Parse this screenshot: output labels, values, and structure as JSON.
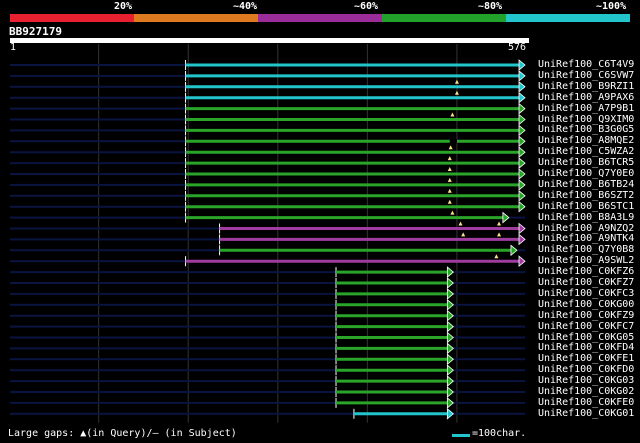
{
  "legend": {
    "bands": [
      {
        "label": "20%",
        "color": "#e8202f"
      },
      {
        "label": "~40%",
        "color": "#e07a20"
      },
      {
        "label": "~60%",
        "color": "#9b2d9a"
      },
      {
        "label": "~80%",
        "color": "#22a22a"
      },
      {
        "label": "~100%",
        "color": "#22c5cc"
      }
    ]
  },
  "query": {
    "id": "BB927179",
    "start": "1",
    "end": "576"
  },
  "axis": {
    "length": 576,
    "gridlines": [
      100,
      200,
      300,
      400,
      500
    ]
  },
  "colors": {
    "identity_80": "#2aa52a",
    "identity_60": "#a03ca0",
    "identity_100": "#22c5cc",
    "baseline": "#0a1440",
    "grid": "#333333"
  },
  "hits": [
    {
      "name": "UniRef100_C6T4V9",
      "start": 197,
      "end": 576,
      "color": "#22c5cc",
      "gaps": []
    },
    {
      "name": "UniRef100_C6SVW7",
      "start": 197,
      "end": 576,
      "color": "#22c5cc",
      "gaps": []
    },
    {
      "name": "UniRef100_B9RZI1",
      "start": 197,
      "end": 576,
      "color": "#22c5cc",
      "gaps": [
        500
      ]
    },
    {
      "name": "UniRef100_A9PAX6",
      "start": 197,
      "end": 576,
      "color": "#22c5cc",
      "gaps": [
        500
      ]
    },
    {
      "name": "UniRef100_A7P9B1",
      "start": 197,
      "end": 576,
      "color": "#2aa52a",
      "gaps": []
    },
    {
      "name": "UniRef100_Q9XIM0",
      "start": 197,
      "end": 576,
      "color": "#2aa52a",
      "gaps": [
        495
      ]
    },
    {
      "name": "UniRef100_B3G0G5",
      "start": 197,
      "end": 576,
      "color": "#2aa52a",
      "gaps": []
    },
    {
      "name": "UniRef100_A8MQE2",
      "start": 197,
      "end": 576,
      "color": "#2aa52a",
      "gaps": []
    },
    {
      "name": "UniRef100_C5WZA2",
      "start": 197,
      "end": 576,
      "color": "#2aa52a",
      "gaps": [
        493
      ]
    },
    {
      "name": "UniRef100_B6TCR5",
      "start": 197,
      "end": 576,
      "color": "#2aa52a",
      "gaps": [
        492
      ]
    },
    {
      "name": "UniRef100_Q7Y0E0",
      "start": 197,
      "end": 576,
      "color": "#2aa52a",
      "gaps": [
        492
      ]
    },
    {
      "name": "UniRef100_B6TB24",
      "start": 197,
      "end": 576,
      "color": "#2aa52a",
      "gaps": [
        492
      ]
    },
    {
      "name": "UniRef100_B6SZT2",
      "start": 197,
      "end": 576,
      "color": "#2aa52a",
      "gaps": [
        492
      ]
    },
    {
      "name": "UniRef100_B6STC1",
      "start": 197,
      "end": 576,
      "color": "#2aa52a",
      "gaps": [
        492
      ]
    },
    {
      "name": "UniRef100_B8A3L9",
      "start": 197,
      "end": 558,
      "color": "#2aa52a",
      "gaps": [
        495
      ]
    },
    {
      "name": "UniRef100_A9NZQ2",
      "start": 235,
      "end": 576,
      "color": "#a03ca0",
      "gaps": [
        504,
        547
      ]
    },
    {
      "name": "UniRef100_A9NTK4",
      "start": 235,
      "end": 576,
      "color": "#a03ca0",
      "gaps": [
        507,
        547
      ]
    },
    {
      "name": "UniRef100_Q7Y0B8",
      "start": 235,
      "end": 567,
      "color": "#2aa52a",
      "gaps": []
    },
    {
      "name": "UniRef100_A9SWL2",
      "start": 197,
      "end": 576,
      "color": "#a03ca0",
      "gaps": [
        544
      ]
    },
    {
      "name": "UniRef100_C0KFZ6",
      "start": 365,
      "end": 496,
      "color": "#2aa52a",
      "gaps": []
    },
    {
      "name": "UniRef100_C0KFZ7",
      "start": 365,
      "end": 496,
      "color": "#2aa52a",
      "gaps": []
    },
    {
      "name": "UniRef100_C0KFC3",
      "start": 365,
      "end": 496,
      "color": "#2aa52a",
      "gaps": []
    },
    {
      "name": "UniRef100_C0KG00",
      "start": 365,
      "end": 496,
      "color": "#2aa52a",
      "gaps": []
    },
    {
      "name": "UniRef100_C0KFZ9",
      "start": 365,
      "end": 496,
      "color": "#2aa52a",
      "gaps": []
    },
    {
      "name": "UniRef100_C0KFC7",
      "start": 365,
      "end": 496,
      "color": "#2aa52a",
      "gaps": []
    },
    {
      "name": "UniRef100_C0KG05",
      "start": 365,
      "end": 496,
      "color": "#2aa52a",
      "gaps": []
    },
    {
      "name": "UniRef100_C0KFD4",
      "start": 365,
      "end": 496,
      "color": "#2aa52a",
      "gaps": []
    },
    {
      "name": "UniRef100_C0KFE1",
      "start": 365,
      "end": 496,
      "color": "#2aa52a",
      "gaps": []
    },
    {
      "name": "UniRef100_C0KFD0",
      "start": 365,
      "end": 496,
      "color": "#2aa52a",
      "gaps": []
    },
    {
      "name": "UniRef100_C0KG03",
      "start": 365,
      "end": 496,
      "color": "#2aa52a",
      "gaps": []
    },
    {
      "name": "UniRef100_C0KG02",
      "start": 365,
      "end": 496,
      "color": "#2aa52a",
      "gaps": []
    },
    {
      "name": "UniRef100_C0KFE0",
      "start": 365,
      "end": 496,
      "color": "#2aa52a",
      "gaps": []
    },
    {
      "name": "UniRef100_C0KG01",
      "start": 385,
      "end": 496,
      "color": "#22c5cc",
      "gaps": []
    }
  ],
  "footer": {
    "gaps_text": "Large gaps: ▲(in Query)/– (in Subject)",
    "scale_text": "=100char."
  }
}
